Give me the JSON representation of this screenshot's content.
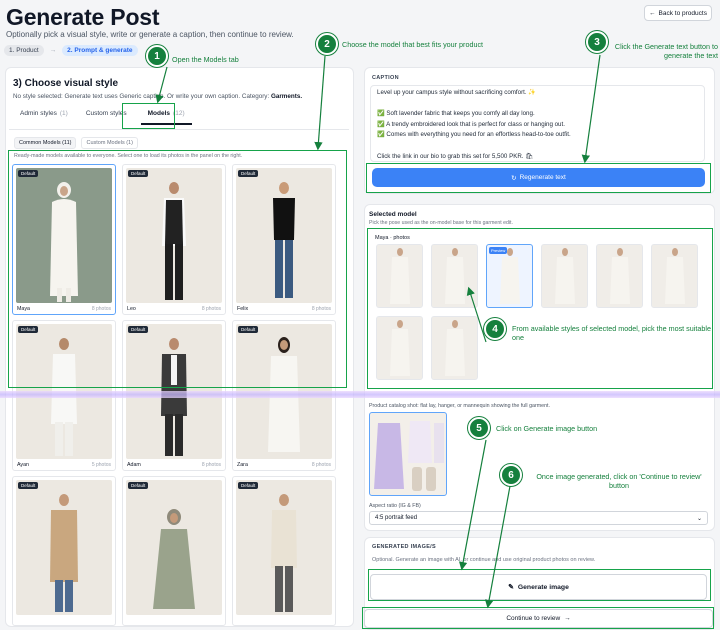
{
  "header": {
    "title": "Generate Post",
    "subtitle": "Optionally pick a visual style, write or generate a caption, then continue to review.",
    "back_label": "Back to products",
    "steps": [
      "1. Product",
      "→",
      "2. Prompt & generate"
    ]
  },
  "visual_style": {
    "title": "3) Choose visual style",
    "desc_prefix": "No style selected: Generate text uses Generic caption. Or write your own caption. Category:",
    "category": "Garments.",
    "tabs": [
      {
        "label": "Admin styles",
        "count": "(1)"
      },
      {
        "label": "Custom styles",
        "count": ""
      },
      {
        "label": "Models",
        "count": "(12)"
      }
    ],
    "subtabs": [
      "Common Models (11)",
      "Custom Models (1)"
    ],
    "grid_note": "Ready-made models available to everyone. Select one to load its photos in the panel on the right.",
    "models": [
      {
        "name": "Maya",
        "count": "8 photos",
        "badge": "Default"
      },
      {
        "name": "Leo",
        "count": "8 photos",
        "badge": "Default"
      },
      {
        "name": "Felix",
        "count": "8 photos",
        "badge": "Default"
      },
      {
        "name": "Ayan",
        "count": "5 photos",
        "badge": "Default"
      },
      {
        "name": "Adam",
        "count": "8 photos",
        "badge": "Default"
      },
      {
        "name": "Zara",
        "count": "8 photos",
        "badge": "Default"
      },
      {
        "name": "",
        "count": "",
        "badge": "Default"
      },
      {
        "name": "",
        "count": "",
        "badge": "Default"
      },
      {
        "name": "",
        "count": "",
        "badge": "Default"
      }
    ]
  },
  "caption": {
    "label": "CAPTION",
    "text": "Level up your campus style without sacrificing comfort. ✨\n\n✅ Soft lavender fabric that keeps you comfy all day long.\n✅ A trendy embroidered look that is perfect for class or hanging out.\n✅ Comes with everything you need for an effortless head-to-toe outfit.\n\nClick the link in our bio to grab this set for 5,500 PKR. 🛍\n\n#CollegeFashion #OOTD #DesiStyle #EverydayElegance #StudentStyle #PakistaniFashion #OutfitInspiration",
    "regen_label": "Regenerate text"
  },
  "selected_model": {
    "title": "Selected model",
    "desc": "Pick the pose used as the on-model base for this garment edit.",
    "photos_label": "Maya · photos",
    "preview_badge": "Preview",
    "catalog_text": "Product catalog shot: flat lay, hanger, or mannequin showing the full garment.",
    "aspect_label": "Aspect ratio (IG & FB)",
    "aspect_value": "4:5 portrait feed"
  },
  "generated": {
    "title": "GENERATED IMAGE/S",
    "desc": "Optional. Generate an image with AI, or continue and use original product photos on review.",
    "button_label": "Generate image",
    "continue_label": "Continue to review"
  },
  "annotations": [
    {
      "num": "1",
      "text": "Open the Models tab"
    },
    {
      "num": "2",
      "text": "Choose the model that best fits your product"
    },
    {
      "num": "3",
      "text": "Click the Generate text button to generate the text"
    },
    {
      "num": "4",
      "text": "From available styles of selected model, pick the most suitable one"
    },
    {
      "num": "5",
      "text": "Click on Generate image button"
    },
    {
      "num": "6",
      "text": "Once image generated, click on 'Continue to review' button"
    }
  ],
  "colors": {
    "accent": "#3b82f6",
    "annotation": "#15803d",
    "selected_border": "#60a5fa"
  },
  "icons": [
    "arrow-left-icon",
    "refresh-icon",
    "pencil-icon",
    "arrow-right-icon",
    "chevron-down-icon"
  ]
}
